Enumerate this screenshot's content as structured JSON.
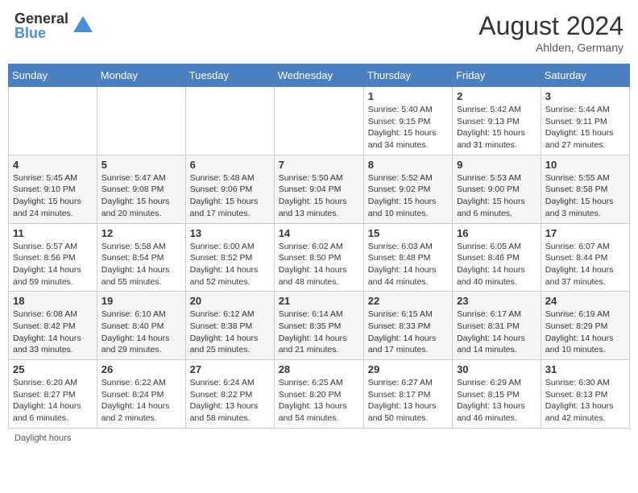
{
  "header": {
    "logo_general": "General",
    "logo_blue": "Blue",
    "month_year": "August 2024",
    "location": "Ahlden, Germany"
  },
  "days_of_week": [
    "Sunday",
    "Monday",
    "Tuesday",
    "Wednesday",
    "Thursday",
    "Friday",
    "Saturday"
  ],
  "footer": {
    "daylight_label": "Daylight hours"
  },
  "weeks": [
    [
      {
        "day": "",
        "info": ""
      },
      {
        "day": "",
        "info": ""
      },
      {
        "day": "",
        "info": ""
      },
      {
        "day": "",
        "info": ""
      },
      {
        "day": "1",
        "info": "Sunrise: 5:40 AM\nSunset: 9:15 PM\nDaylight: 15 hours\nand 34 minutes."
      },
      {
        "day": "2",
        "info": "Sunrise: 5:42 AM\nSunset: 9:13 PM\nDaylight: 15 hours\nand 31 minutes."
      },
      {
        "day": "3",
        "info": "Sunrise: 5:44 AM\nSunset: 9:11 PM\nDaylight: 15 hours\nand 27 minutes."
      }
    ],
    [
      {
        "day": "4",
        "info": "Sunrise: 5:45 AM\nSunset: 9:10 PM\nDaylight: 15 hours\nand 24 minutes."
      },
      {
        "day": "5",
        "info": "Sunrise: 5:47 AM\nSunset: 9:08 PM\nDaylight: 15 hours\nand 20 minutes."
      },
      {
        "day": "6",
        "info": "Sunrise: 5:48 AM\nSunset: 9:06 PM\nDaylight: 15 hours\nand 17 minutes."
      },
      {
        "day": "7",
        "info": "Sunrise: 5:50 AM\nSunset: 9:04 PM\nDaylight: 15 hours\nand 13 minutes."
      },
      {
        "day": "8",
        "info": "Sunrise: 5:52 AM\nSunset: 9:02 PM\nDaylight: 15 hours\nand 10 minutes."
      },
      {
        "day": "9",
        "info": "Sunrise: 5:53 AM\nSunset: 9:00 PM\nDaylight: 15 hours\nand 6 minutes."
      },
      {
        "day": "10",
        "info": "Sunrise: 5:55 AM\nSunset: 8:58 PM\nDaylight: 15 hours\nand 3 minutes."
      }
    ],
    [
      {
        "day": "11",
        "info": "Sunrise: 5:57 AM\nSunset: 8:56 PM\nDaylight: 14 hours\nand 59 minutes."
      },
      {
        "day": "12",
        "info": "Sunrise: 5:58 AM\nSunset: 8:54 PM\nDaylight: 14 hours\nand 55 minutes."
      },
      {
        "day": "13",
        "info": "Sunrise: 6:00 AM\nSunset: 8:52 PM\nDaylight: 14 hours\nand 52 minutes."
      },
      {
        "day": "14",
        "info": "Sunrise: 6:02 AM\nSunset: 8:50 PM\nDaylight: 14 hours\nand 48 minutes."
      },
      {
        "day": "15",
        "info": "Sunrise: 6:03 AM\nSunset: 8:48 PM\nDaylight: 14 hours\nand 44 minutes."
      },
      {
        "day": "16",
        "info": "Sunrise: 6:05 AM\nSunset: 8:46 PM\nDaylight: 14 hours\nand 40 minutes."
      },
      {
        "day": "17",
        "info": "Sunrise: 6:07 AM\nSunset: 8:44 PM\nDaylight: 14 hours\nand 37 minutes."
      }
    ],
    [
      {
        "day": "18",
        "info": "Sunrise: 6:08 AM\nSunset: 8:42 PM\nDaylight: 14 hours\nand 33 minutes."
      },
      {
        "day": "19",
        "info": "Sunrise: 6:10 AM\nSunset: 8:40 PM\nDaylight: 14 hours\nand 29 minutes."
      },
      {
        "day": "20",
        "info": "Sunrise: 6:12 AM\nSunset: 8:38 PM\nDaylight: 14 hours\nand 25 minutes."
      },
      {
        "day": "21",
        "info": "Sunrise: 6:14 AM\nSunset: 8:35 PM\nDaylight: 14 hours\nand 21 minutes."
      },
      {
        "day": "22",
        "info": "Sunrise: 6:15 AM\nSunset: 8:33 PM\nDaylight: 14 hours\nand 17 minutes."
      },
      {
        "day": "23",
        "info": "Sunrise: 6:17 AM\nSunset: 8:31 PM\nDaylight: 14 hours\nand 14 minutes."
      },
      {
        "day": "24",
        "info": "Sunrise: 6:19 AM\nSunset: 8:29 PM\nDaylight: 14 hours\nand 10 minutes."
      }
    ],
    [
      {
        "day": "25",
        "info": "Sunrise: 6:20 AM\nSunset: 8:27 PM\nDaylight: 14 hours\nand 6 minutes."
      },
      {
        "day": "26",
        "info": "Sunrise: 6:22 AM\nSunset: 8:24 PM\nDaylight: 14 hours\nand 2 minutes."
      },
      {
        "day": "27",
        "info": "Sunrise: 6:24 AM\nSunset: 8:22 PM\nDaylight: 13 hours\nand 58 minutes."
      },
      {
        "day": "28",
        "info": "Sunrise: 6:25 AM\nSunset: 8:20 PM\nDaylight: 13 hours\nand 54 minutes."
      },
      {
        "day": "29",
        "info": "Sunrise: 6:27 AM\nSunset: 8:17 PM\nDaylight: 13 hours\nand 50 minutes."
      },
      {
        "day": "30",
        "info": "Sunrise: 6:29 AM\nSunset: 8:15 PM\nDaylight: 13 hours\nand 46 minutes."
      },
      {
        "day": "31",
        "info": "Sunrise: 6:30 AM\nSunset: 8:13 PM\nDaylight: 13 hours\nand 42 minutes."
      }
    ]
  ]
}
